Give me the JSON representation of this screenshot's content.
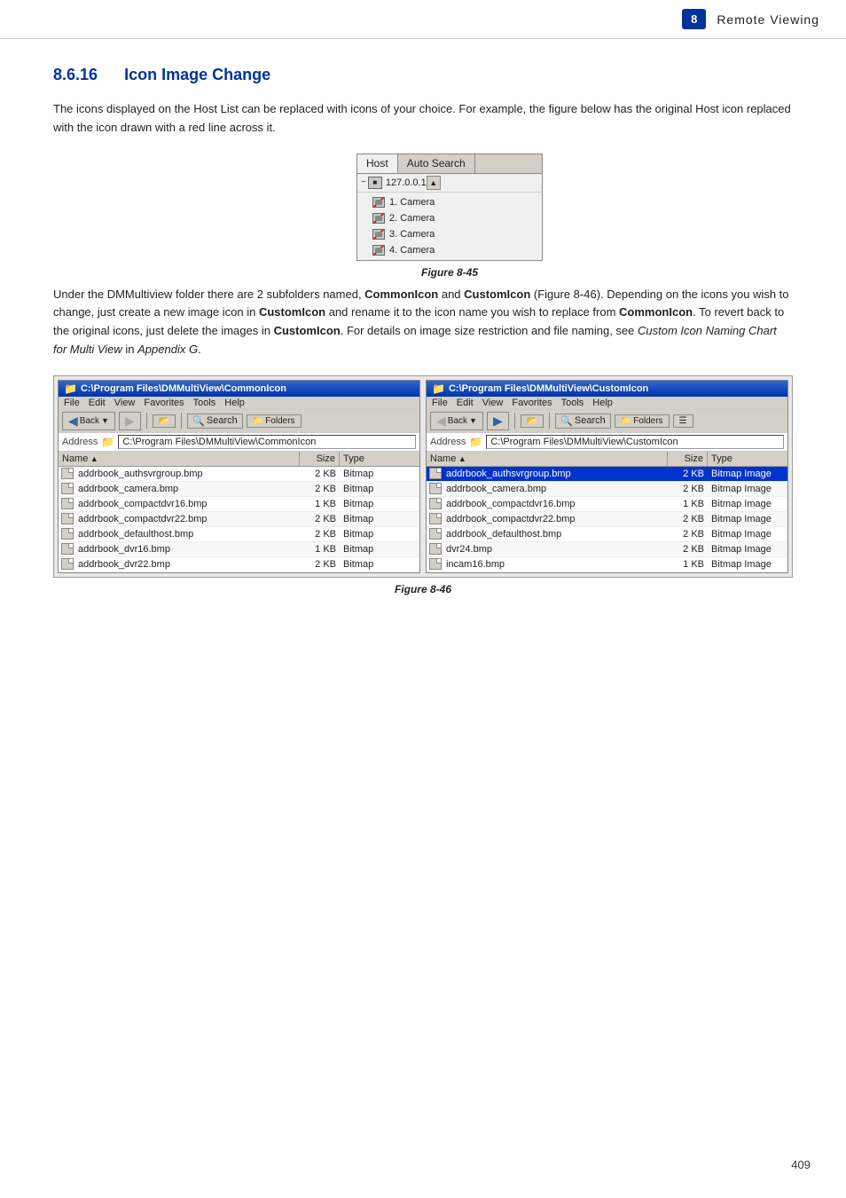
{
  "header": {
    "page_number": "8",
    "title": "Remote  Viewing"
  },
  "section": {
    "number": "8.6.16",
    "title": "Icon Image Change"
  },
  "body_paragraph_1": "The icons displayed on the Host List can be replaced with icons of your choice. For example, the figure below has the original Host icon replaced with the icon drawn with a red line across it.",
  "figure_45": {
    "caption": "Figure 8-45",
    "host_tab": "Host",
    "autosearch_tab": "Auto Search",
    "ip_address": "127.0.0.1",
    "cameras": [
      "1. Camera",
      "2. Camera",
      "3. Camera",
      "4. Camera"
    ]
  },
  "body_paragraph_2_parts": {
    "pre1": "Under the DMMultiview folder there are 2 subfolders named, ",
    "bold1": "CommonIcon",
    "mid1": " and ",
    "bold2": "CustomIcon",
    "mid2": " (Figure 8-46). Depending on the icons you wish to change, just create a new image icon in ",
    "bold3": "CustomIcon",
    "mid3": " and rename it to the icon name you wish to replace from ",
    "bold4": "CommonIcon",
    "mid4": ". To revert back to the original icons, just delete the images in ",
    "bold5": "CustomIcon",
    "mid5": ". For details on image size restriction and file naming, see ",
    "italic1": "Custom Icon Naming Chart for Multi View",
    "mid6": " in ",
    "italic2": "Appendix G",
    "end": "."
  },
  "figure_46": {
    "caption": "Figure 8-46",
    "left_window": {
      "title": "C:\\Program Files\\DMMultiView\\CommonIcon",
      "menu": [
        "File",
        "Edit",
        "View",
        "Favorites",
        "Tools",
        "Help"
      ],
      "back_btn": "Back",
      "search_btn": "Search",
      "folders_btn": "Folders",
      "address_label": "Address",
      "address_value": "C:\\Program Files\\DMMultiView\\CommonIcon",
      "columns": [
        "Name",
        "Size",
        "Type"
      ],
      "files": [
        {
          "name": "addrbook_authsvrgroup.bmp",
          "size": "2 KB",
          "type": "Bitmap"
        },
        {
          "name": "addrbook_camera.bmp",
          "size": "2 KB",
          "type": "Bitmap"
        },
        {
          "name": "addrbook_compactdvr16.bmp",
          "size": "1 KB",
          "type": "Bitmap"
        },
        {
          "name": "addrbook_compactdvr22.bmp",
          "size": "2 KB",
          "type": "Bitmap"
        },
        {
          "name": "addrbook_defaulthost.bmp",
          "size": "2 KB",
          "type": "Bitmap"
        },
        {
          "name": "addrbook_dvr16.bmp",
          "size": "1 KB",
          "type": "Bitmap"
        },
        {
          "name": "addrbook_dvr22.bmp",
          "size": "2 KB",
          "type": "Bitmap"
        }
      ]
    },
    "right_window": {
      "title": "C:\\Program Files\\DMMultiView\\CustomIcon",
      "menu": [
        "File",
        "Edit",
        "View",
        "Favorites",
        "Tools",
        "Help"
      ],
      "back_btn": "Back",
      "search_btn": "Search",
      "folders_btn": "Folders",
      "address_label": "Address",
      "address_value": "C:\\Program Files\\DMMultiView\\CustomIcon",
      "columns": [
        "Name",
        "Size",
        "Type"
      ],
      "files": [
        {
          "name": "addrbook_authsvrgroup.bmp",
          "size": "2 KB",
          "type": "Bitmap Image",
          "highlight": true
        },
        {
          "name": "addrbook_camera.bmp",
          "size": "2 KB",
          "type": "Bitmap Image"
        },
        {
          "name": "addrbook_compactdvr16.bmp",
          "size": "1 KB",
          "type": "Bitmap Image"
        },
        {
          "name": "addrbook_compactdvr22.bmp",
          "size": "2 KB",
          "type": "Bitmap Image"
        },
        {
          "name": "addrbook_defaulthost.bmp",
          "size": "2 KB",
          "type": "Bitmap Image"
        },
        {
          "name": "dvr24.bmp",
          "size": "2 KB",
          "type": "Bitmap Image"
        },
        {
          "name": "incam16.bmp",
          "size": "1 KB",
          "type": "Bitmap Image"
        }
      ]
    }
  },
  "page_number": "409"
}
